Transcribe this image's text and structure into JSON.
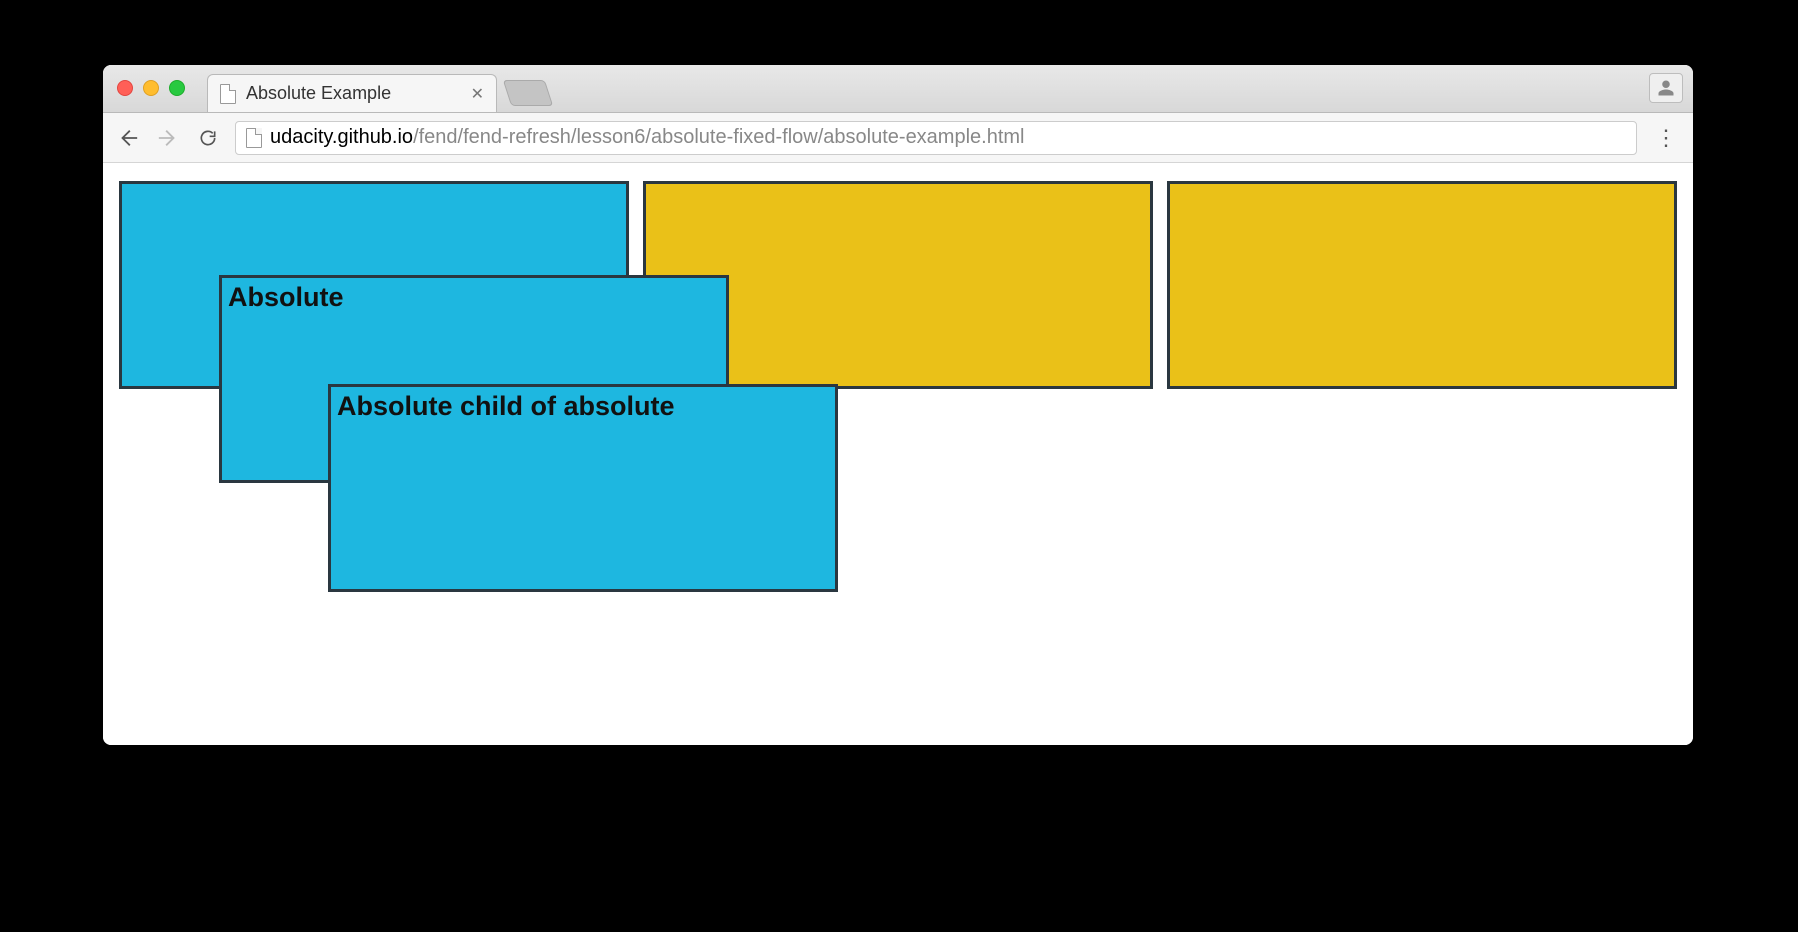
{
  "tab": {
    "title": "Absolute Example"
  },
  "url": {
    "host": "udacity.github.io",
    "path": "/fend/fend-refresh/lesson6/absolute-fixed-flow/absolute-example.html"
  },
  "page": {
    "absolute_label": "Absolute",
    "absolute_child_label": "Absolute child of absolute"
  }
}
